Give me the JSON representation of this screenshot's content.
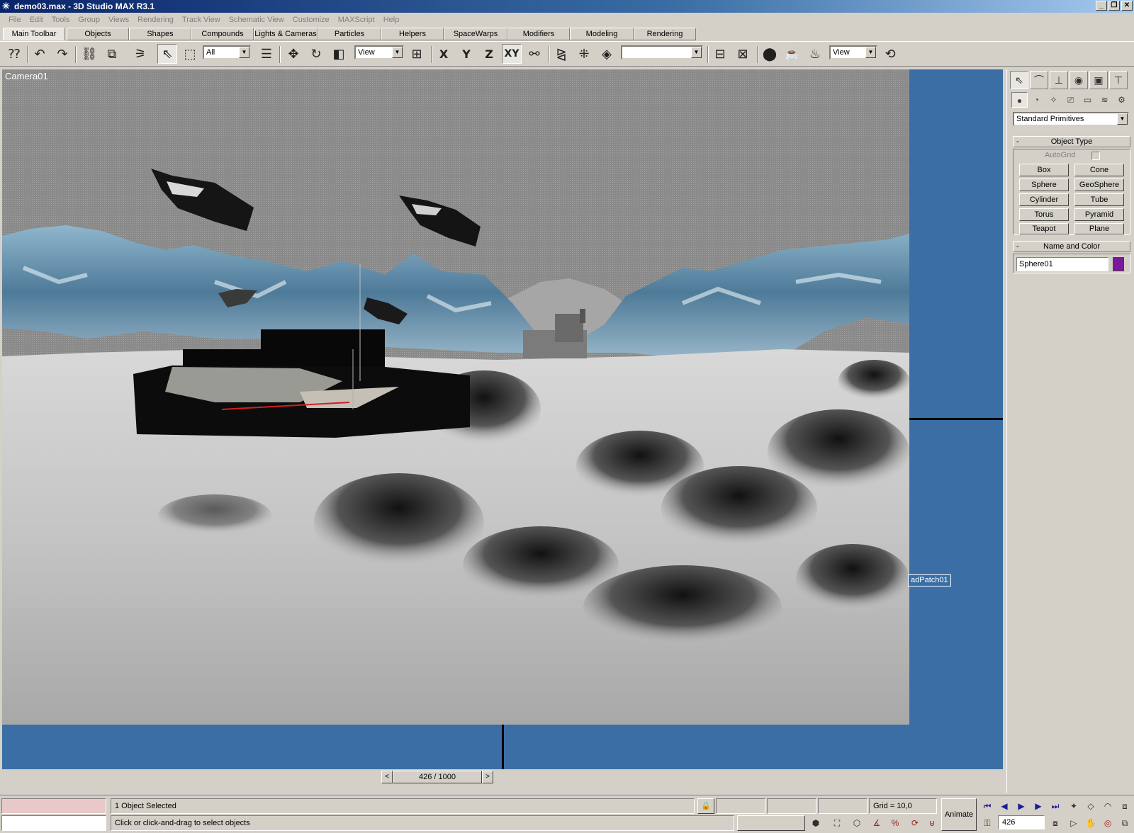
{
  "window": {
    "title": "demo03.max - 3D Studio MAX R3.1"
  },
  "menu": [
    "File",
    "Edit",
    "Tools",
    "Group",
    "Views",
    "Rendering",
    "Track View",
    "Schematic View",
    "Customize",
    "MAXScript",
    "Help"
  ],
  "tabs": [
    "Main Toolbar",
    "Objects",
    "Shapes",
    "Compounds",
    "Lights & Cameras",
    "Particles",
    "Helpers",
    "SpaceWarps",
    "Modifiers",
    "Modeling",
    "Rendering"
  ],
  "toolbar": {
    "selection_filter": "All",
    "ref_coord": "View",
    "named_selection": "",
    "render_type": "View",
    "axis_x": "X",
    "axis_y": "Y",
    "axis_z": "Z",
    "axis_xy": "XY"
  },
  "viewport": {
    "label": "Camera01",
    "object_tag": "adPatch01"
  },
  "time": {
    "slider_label": "426 / 1000",
    "left_arrow": "<",
    "right_arrow": ">"
  },
  "status": {
    "selection_text": "1 Object Selected",
    "prompt_text": "Click or click-and-drag to select objects",
    "grid_text": "Grid = 10,0",
    "animate_label": "Animate",
    "frame_value": "426"
  },
  "command_panel": {
    "dropdown": "Standard Primitives",
    "object_type_title": "Object Type",
    "autogrid_label": "AutoGrid",
    "buttons": [
      "Box",
      "Cone",
      "Sphere",
      "GeoSphere",
      "Cylinder",
      "Tube",
      "Torus",
      "Pyramid",
      "Teapot",
      "Plane"
    ],
    "name_color_title": "Name and Color",
    "object_name": "Sphere01",
    "object_color": "#7a1a9a"
  },
  "colors": {
    "viewport_bg": "#3a6ea5",
    "ui_gray": "#d4d0c8",
    "title_blue": "#0a246a"
  }
}
